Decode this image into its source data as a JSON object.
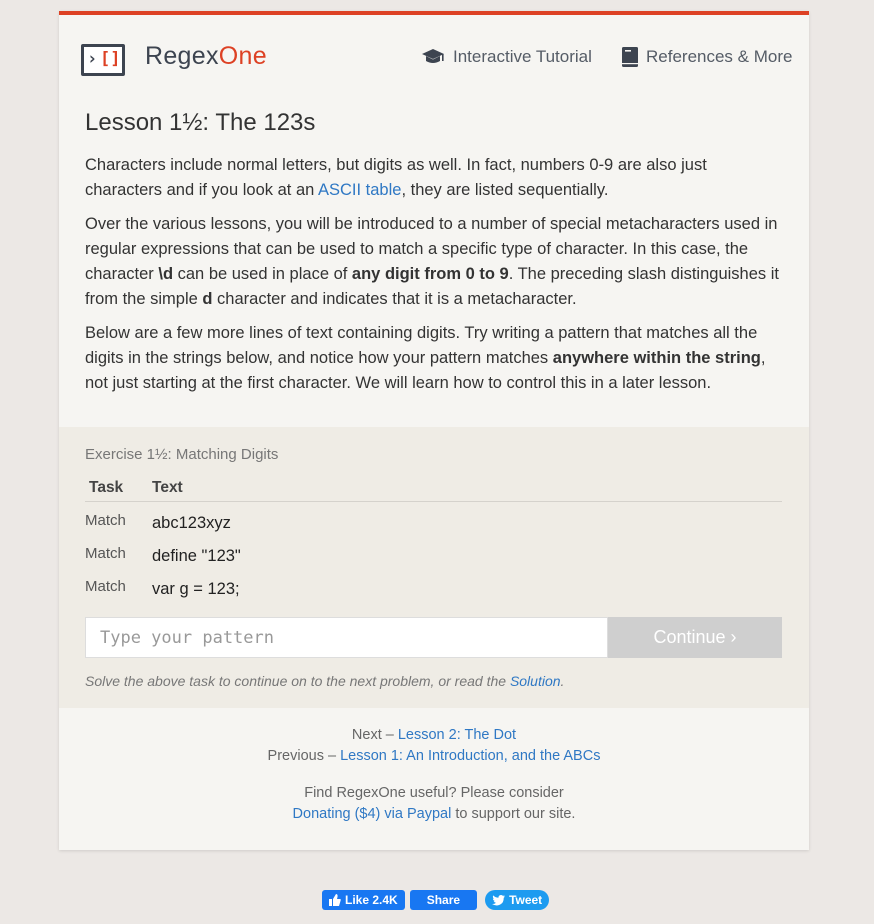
{
  "header": {
    "brand_main": "Regex",
    "brand_accent": "One",
    "nav": [
      {
        "label": "Interactive Tutorial",
        "icon": "graduation-cap-icon"
      },
      {
        "label": "References & More",
        "icon": "book-icon"
      }
    ]
  },
  "lesson": {
    "title": "Lesson 1½: The 123s",
    "p1_a": "Characters include normal letters, but digits as well. In fact, numbers 0-9 are also just characters and if you look at an ",
    "p1_link": "ASCII table",
    "p1_b": ", they are listed sequentially.",
    "p2_a": "Over the various lessons, you will be introduced to a number of special metacharacters used in regular expressions that can be used to match a specific type of character. In this case, the character ",
    "p2_b1": "\\d",
    "p2_b": " can be used in place of ",
    "p2_b2": "any digit from 0 to 9",
    "p2_c": ". The preceding slash distinguishes it from the simple ",
    "p2_b3": "d",
    "p2_d": " character and indicates that it is a metacharacter.",
    "p3_a": "Below are a few more lines of text containing digits. Try writing a pattern that matches all the digits in the strings below, and notice how your pattern matches ",
    "p3_b1": "anywhere within the string",
    "p3_b": ", not just starting at the first character. We will learn how to control this in a later lesson."
  },
  "exercise": {
    "title": "Exercise 1½: Matching Digits",
    "col_task": "Task",
    "col_text": "Text",
    "rows": [
      {
        "task": "Match",
        "text": "abc123xyz"
      },
      {
        "task": "Match",
        "text": "define \"123\""
      },
      {
        "task": "Match",
        "text": "var g = 123;"
      }
    ],
    "input_placeholder": "Type your pattern",
    "continue_label": "Continue ›",
    "hint_a": "Solve the above task to continue on to the next problem, or read the ",
    "hint_link": "Solution",
    "hint_b": "."
  },
  "footer": {
    "next_prefix": "Next – ",
    "next_link": "Lesson 2: The Dot",
    "prev_prefix": "Previous – ",
    "prev_link": "Lesson 1: An Introduction, and the ABCs",
    "donate_a": "Find RegexOne useful? Please consider",
    "donate_link": "Donating ($4) via Paypal",
    "donate_b": " to support our site."
  },
  "social": {
    "like_label": "Like 2.4K",
    "share_label": "Share",
    "tweet_label": "Tweet"
  },
  "colors": {
    "accent": "#dd4124",
    "link": "#2f78c4",
    "button_disabled": "#cfcfcf"
  }
}
